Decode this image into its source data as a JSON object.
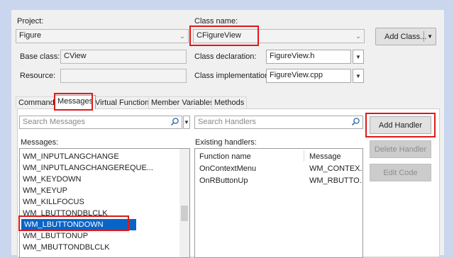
{
  "project": {
    "label": "Project:",
    "value": "Figure"
  },
  "class_name": {
    "label": "Class name:",
    "value": "CFigureView"
  },
  "add_class_button": "Add Class...",
  "base_class": {
    "label": "Base class:",
    "value": "CView"
  },
  "resource": {
    "label": "Resource:",
    "value": ""
  },
  "class_declaration": {
    "label": "Class declaration:",
    "value": "FigureView.h"
  },
  "class_implementation": {
    "label": "Class implementation:",
    "value": "FigureView.cpp"
  },
  "tabs": [
    {
      "label": "Commands"
    },
    {
      "label": "Messages"
    },
    {
      "label": "Virtual Functions"
    },
    {
      "label": "Member Variables"
    },
    {
      "label": "Methods"
    }
  ],
  "search_messages": {
    "placeholder": "Search Messages"
  },
  "search_handlers": {
    "placeholder": "Search Handlers"
  },
  "messages": {
    "label": "Messages:",
    "items": [
      "WM_INPUTLANGCHANGE",
      "WM_INPUTLANGCHANGEREQUE...",
      "WM_KEYDOWN",
      "WM_KEYUP",
      "WM_KILLFOCUS",
      "WM_LBUTTONDBLCLK",
      "WM_LBUTTONDOWN",
      "WM_LBUTTONUP",
      "WM_MBUTTONDBLCLK"
    ],
    "selected": "WM_LBUTTONDOWN"
  },
  "existing_handlers": {
    "label": "Existing handlers:",
    "columns": [
      "Function name",
      "Message"
    ],
    "rows": [
      [
        "OnContextMenu",
        "WM_CONTEX..."
      ],
      [
        "OnRButtonUp",
        "WM_RBUTTO..."
      ]
    ]
  },
  "buttons": {
    "add_handler": "Add Handler",
    "delete_handler": "Delete Handler",
    "edit_code": "Edit Code"
  },
  "icons": {
    "search": "search-icon",
    "dropdown": "chevron-down-icon"
  },
  "colors": {
    "highlight_box": "#e01818",
    "selection": "#0a64c6",
    "background": "#c9d6ee"
  }
}
